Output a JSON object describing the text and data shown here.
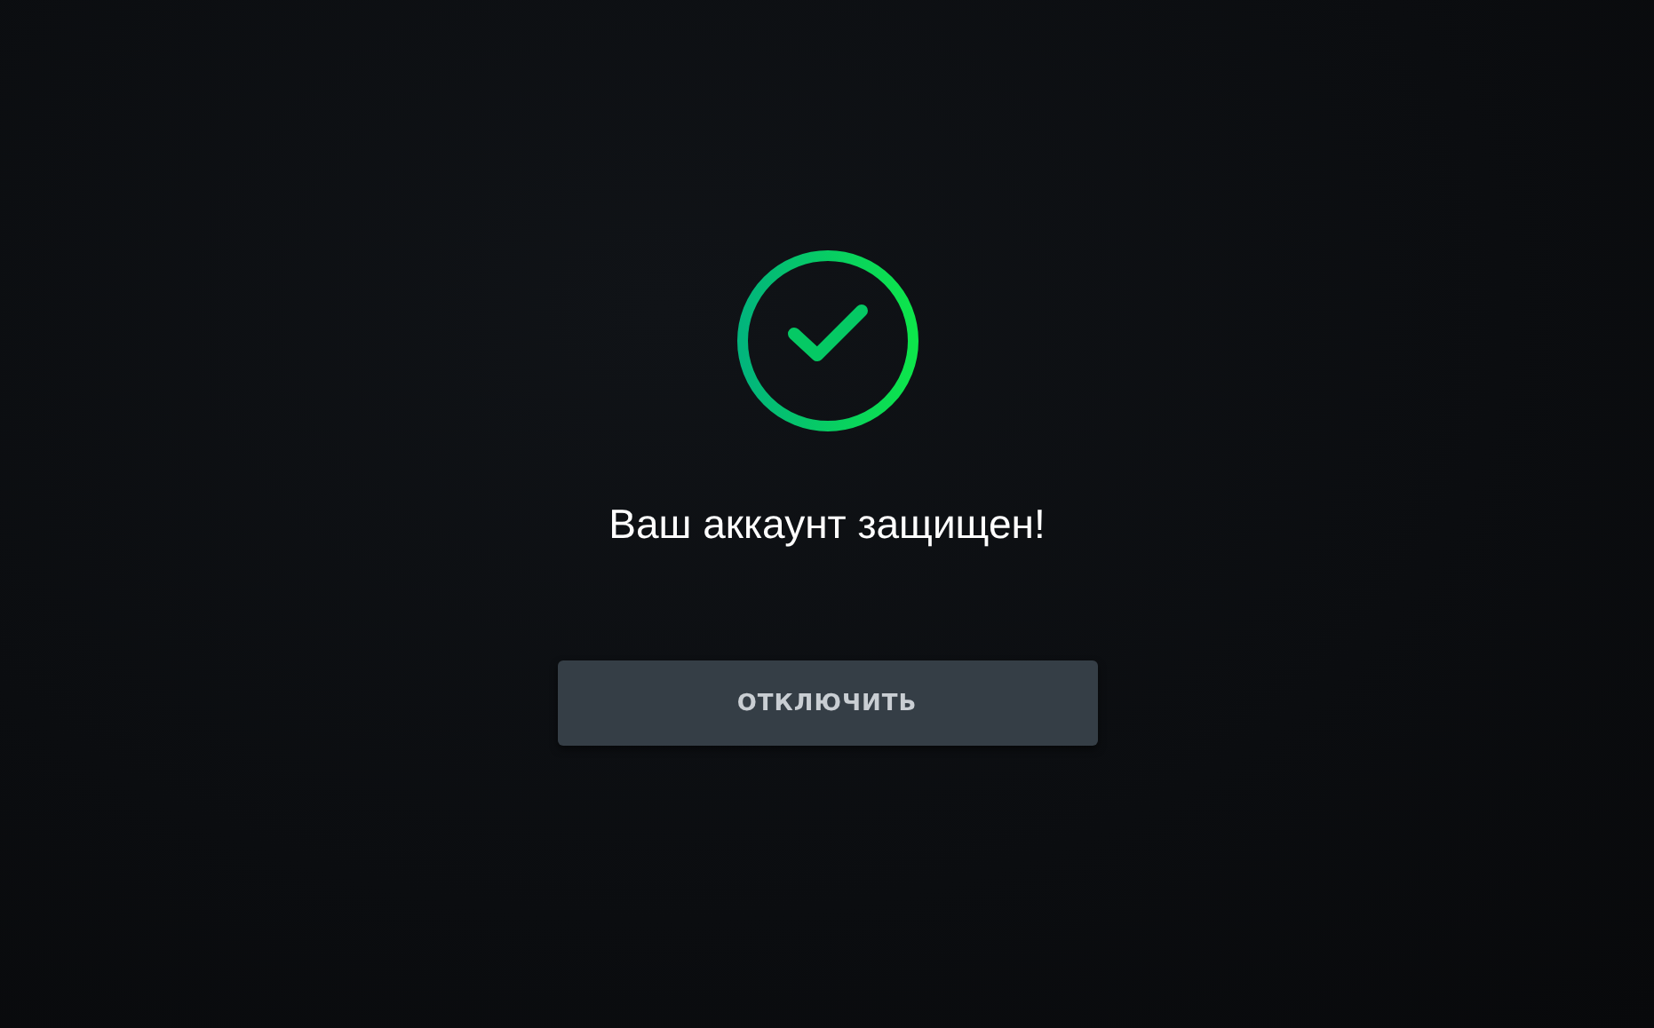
{
  "status": {
    "kind": "success",
    "message": "Ваш аккаунт защищен!"
  },
  "button": {
    "label": "ОТКЛЮЧИТЬ"
  }
}
